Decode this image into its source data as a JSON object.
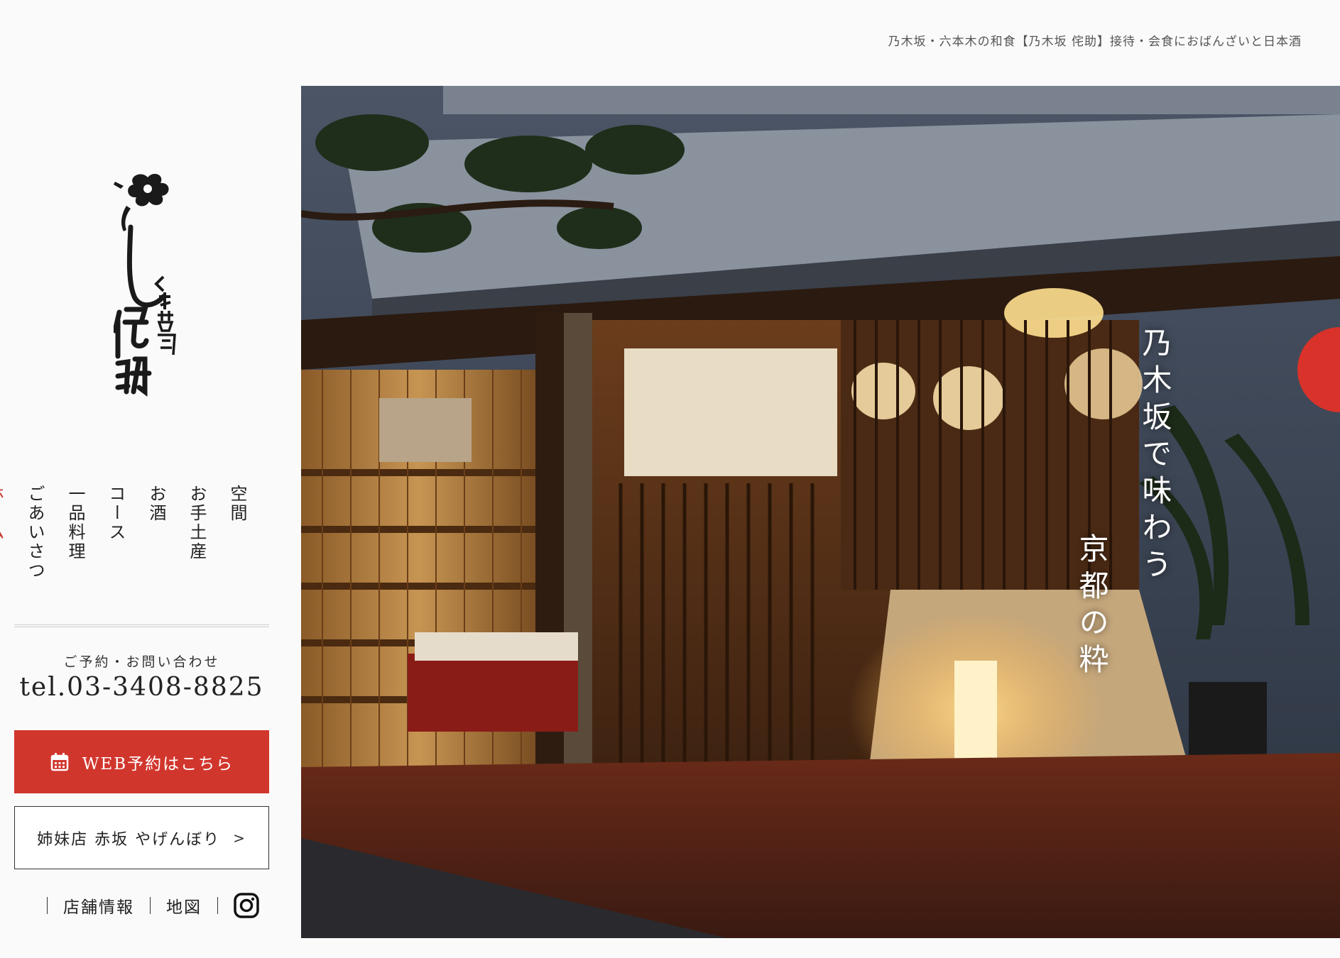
{
  "header": {
    "tagline": "乃木坂・六本木の和食【乃木坂 侘助】接待・会食におばんざいと日本酒"
  },
  "brand": {
    "logo_icon": "camellia-brush-logo",
    "accent_color": "#d1362d"
  },
  "nav": {
    "items": [
      {
        "label": "空間",
        "active": false
      },
      {
        "label": "お手土産",
        "active": false
      },
      {
        "label": "お酒",
        "active": false
      },
      {
        "label": "コース",
        "active": false
      },
      {
        "label": "一品料理",
        "active": false
      },
      {
        "label": "ごあいさつ",
        "active": false
      },
      {
        "label": "ホーム",
        "active": true
      }
    ]
  },
  "contact": {
    "label": "ご予約・お問い合わせ",
    "tel": "tel.03-3408-8825"
  },
  "buttons": {
    "web_reserve": "WEB予約はこちら",
    "web_reserve_icon": "calendar-icon",
    "sister_store": "姉妹店 赤坂 やげんぼり",
    "sister_chevron": ">"
  },
  "footer_links": {
    "store_info": "店舗情報",
    "map": "地図",
    "instagram_icon": "instagram-icon"
  },
  "hero": {
    "line1": "乃木坂で味わう",
    "line2": "京都の粋"
  }
}
